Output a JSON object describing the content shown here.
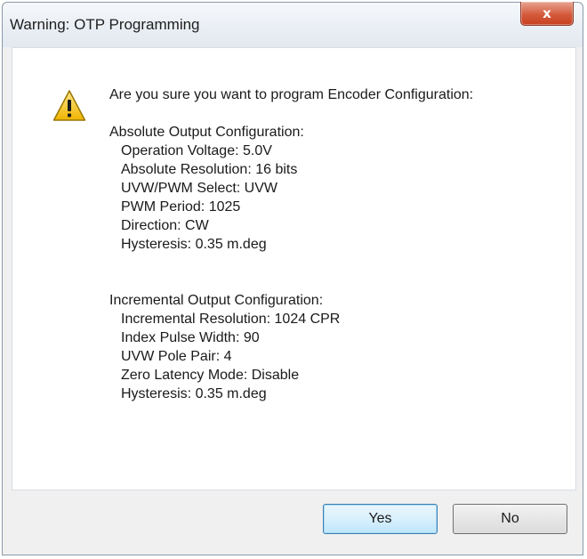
{
  "window": {
    "title": "Warning: OTP Programming",
    "close_glyph": "x"
  },
  "icon": "warning-triangle-icon",
  "message": {
    "question": "Are you sure you want to program Encoder Configuration:",
    "absolute": {
      "heading": "Absolute Output Configuration:",
      "items": [
        "Operation Voltage: 5.0V",
        "Absolute Resolution: 16 bits",
        "UVW/PWM Select: UVW",
        "PWM Period: 1025",
        "Direction: CW",
        "Hysteresis: 0.35 m.deg"
      ]
    },
    "incremental": {
      "heading": "Incremental Output Configuration:",
      "items": [
        "Incremental Resolution: 1024 CPR",
        "Index Pulse Width: 90",
        "UVW Pole Pair: 4",
        "Zero Latency Mode: Disable",
        "Hysteresis: 0.35 m.deg"
      ]
    }
  },
  "buttons": {
    "yes": "Yes",
    "no": "No"
  },
  "colors": {
    "close_button": "#d45b3c",
    "default_button_border": "#3c7fb1",
    "warning_yellow": "#f5c518"
  }
}
